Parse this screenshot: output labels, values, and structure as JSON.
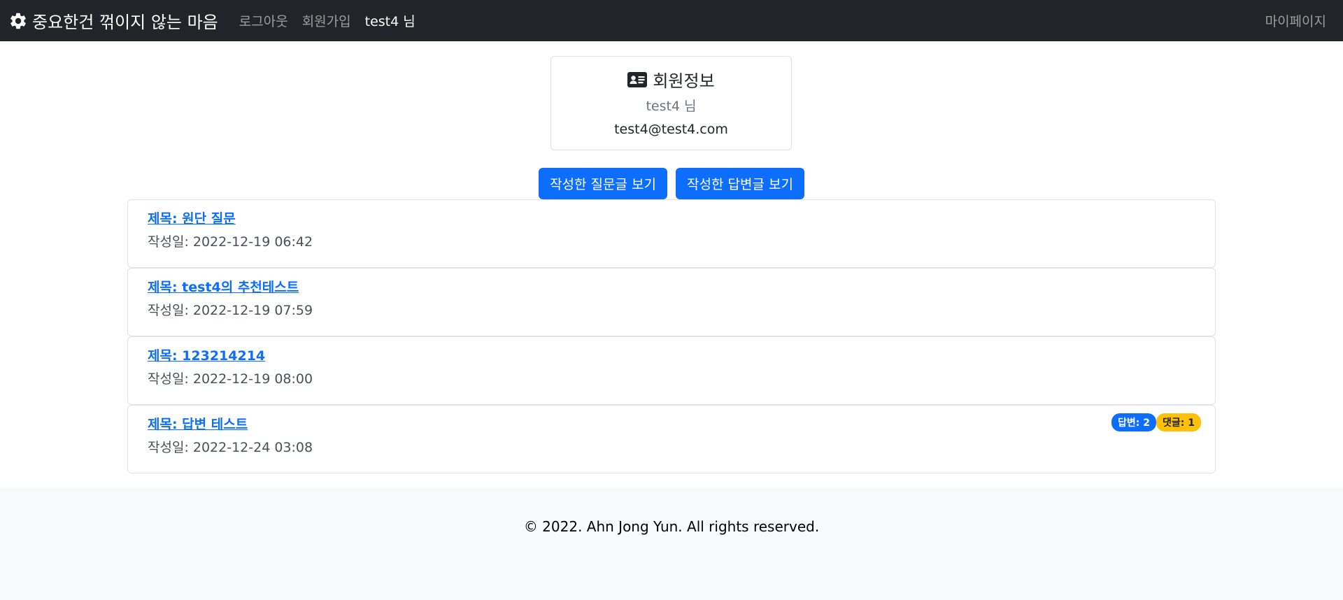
{
  "nav": {
    "brand": "중요한건 꺾이지 않는 마음",
    "links": [
      "로그아웃",
      "회원가입"
    ],
    "user": "test4 님",
    "mypage": "마이페이지"
  },
  "profile": {
    "title": "회원정보",
    "username": "test4 님",
    "email": "test4@test4.com"
  },
  "buttons": {
    "questions": "작성한 질문글 보기",
    "answers": "작성한 답변글 보기"
  },
  "posts": [
    {
      "title": "제목: 원단 질문",
      "date": "작성일: 2022-12-19 06:42"
    },
    {
      "title": "제목: test4의 추천테스트",
      "date": "작성일: 2022-12-19 07:59"
    },
    {
      "title": "제목: 123214214",
      "date": "작성일: 2022-12-19 08:00"
    },
    {
      "title": "제목: 답변 테스트",
      "date": "작성일: 2022-12-24 03:08",
      "answer_badge": "답변: 2",
      "comment_badge": "댓글: 1"
    }
  ],
  "footer": {
    "copyright": "© 2022. Ahn Jong Yun. All rights reserved."
  },
  "colors": {
    "navbar": "#212529",
    "primary": "#0d6efd",
    "warning": "#ffc107",
    "footer_bg": "#f8f9fa"
  }
}
